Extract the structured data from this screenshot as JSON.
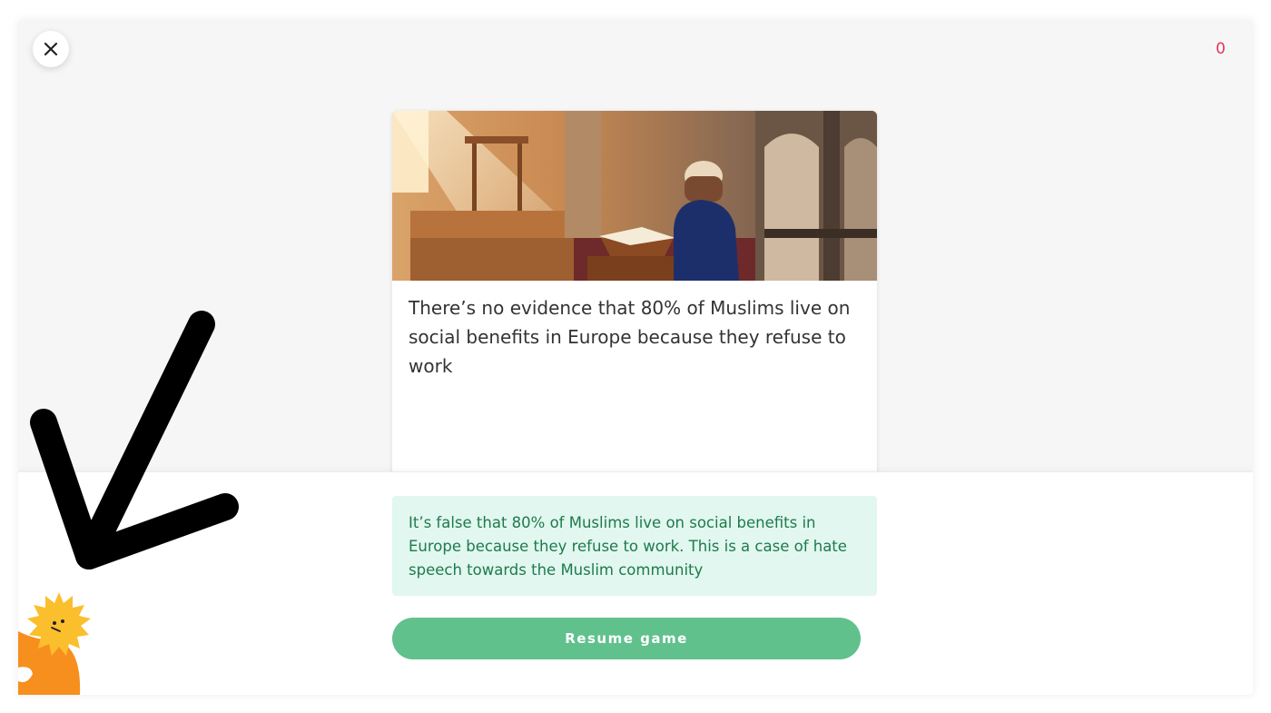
{
  "header": {
    "close_icon": "close-icon",
    "score": "0"
  },
  "card": {
    "image_description_icon": "mosque-prayer-image",
    "statement": "There’s no evidence that 80% of Muslims live on social benefits in Europe because  they refuse to work"
  },
  "feedback": {
    "text": "It’s false that 80% of Muslims live on social benefits in Europe because they refuse to work. This is a case of hate speech towards the Muslim community"
  },
  "actions": {
    "resume_label": "Resume game"
  },
  "colors": {
    "score": "#e8335f",
    "feedback_bg": "#e1f7ef",
    "feedback_text": "#1f7a4d",
    "resume_button": "#60c18d",
    "mascot_sun": "#fbbf2d",
    "mascot_body": "#f78f1e"
  },
  "annotation": {
    "arrow_icon": "hand-drawn-arrow-icon"
  }
}
